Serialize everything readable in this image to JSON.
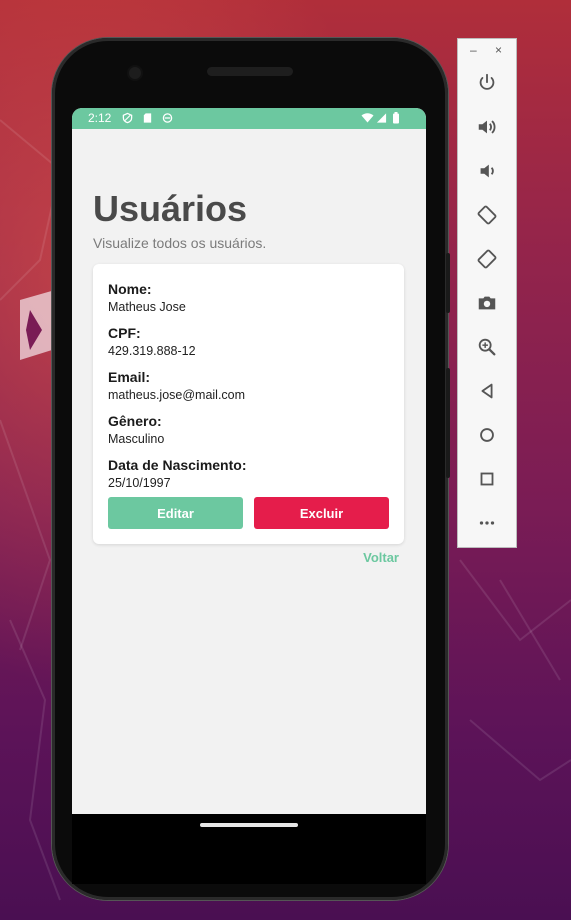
{
  "status_bar": {
    "time": "2:12"
  },
  "page": {
    "title": "Usuários",
    "subtitle": "Visualize todos os usuários."
  },
  "user": {
    "name_label": "Nome:",
    "name": "Matheus Jose",
    "cpf_label": "CPF:",
    "cpf": "429.319.888-12",
    "email_label": "Email:",
    "email": "matheus.jose@mail.com",
    "gender_label": "Gênero:",
    "gender": "Masculino",
    "birth_label": "Data de Nascimento:",
    "birth": "25/10/1997"
  },
  "actions": {
    "edit": "Editar",
    "delete": "Excluir",
    "back": "Voltar"
  },
  "emulator": {
    "minimize": "–",
    "close": "×",
    "tools": [
      "power-icon",
      "volume-up-icon",
      "volume-down-icon",
      "rotate-left-icon",
      "rotate-right-icon",
      "camera-icon",
      "zoom-icon",
      "back-icon",
      "home-icon",
      "overview-icon",
      "more-icon"
    ]
  },
  "colors": {
    "accent": "#6cc8a0",
    "danger": "#e51d4b",
    "title": "#4a4a4a"
  }
}
